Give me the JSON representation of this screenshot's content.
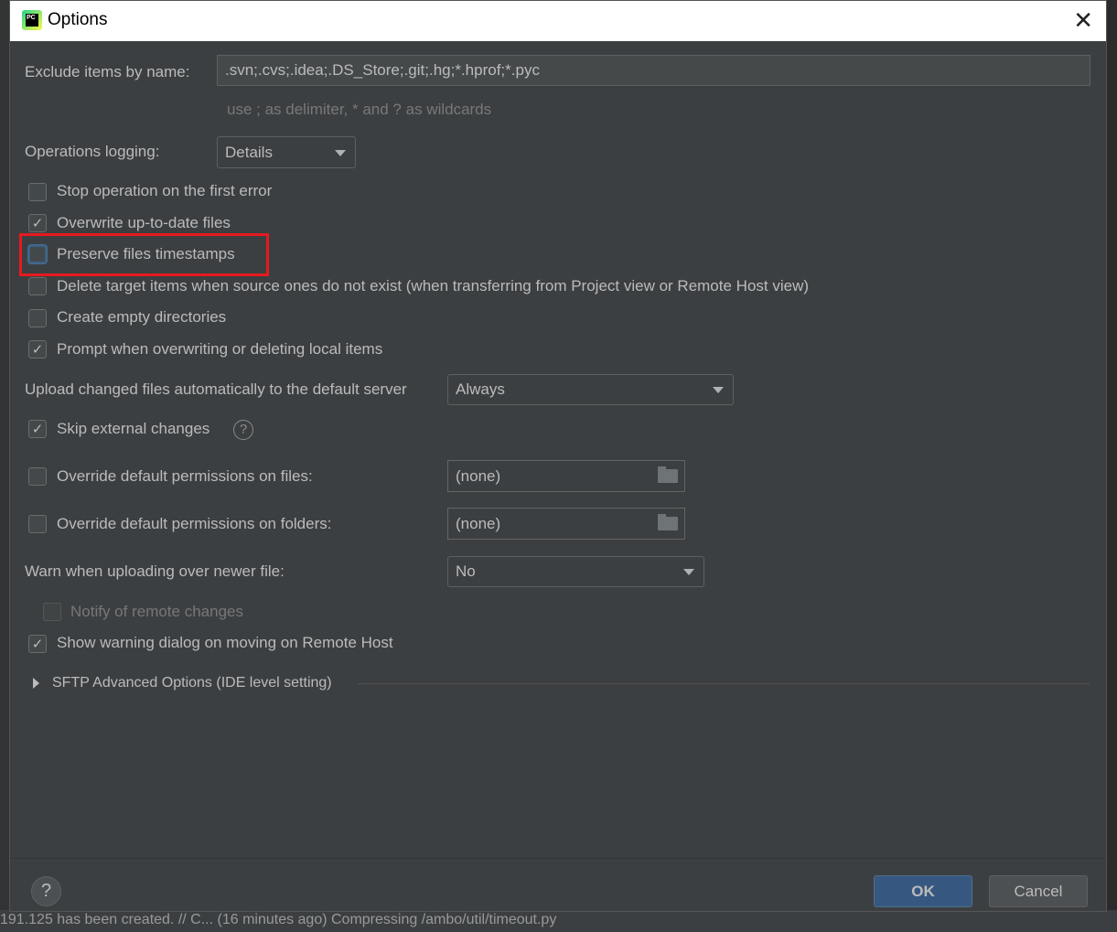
{
  "window": {
    "title": "Options",
    "close_icon": "close-icon"
  },
  "exclude": {
    "label": "Exclude items by name:",
    "value": ".svn;.cvs;.idea;.DS_Store;.git;.hg;*.hprof;*.pyc",
    "hint": "use ; as delimiter, * and ? as wildcards"
  },
  "operations_logging": {
    "label": "Operations logging:",
    "value": "Details"
  },
  "checkboxes": [
    {
      "label": "Stop operation on the first error",
      "checked": false
    },
    {
      "label": "Overwrite up-to-date files",
      "checked": true
    },
    {
      "label": "Preserve files timestamps",
      "checked": false
    },
    {
      "label": "Delete target items when source ones do not exist (when transferring from Project view or Remote Host view)",
      "checked": false
    },
    {
      "label": "Create empty directories",
      "checked": false
    },
    {
      "label": "Prompt when overwriting or deleting local items",
      "checked": true
    }
  ],
  "upload": {
    "label": "Upload changed files automatically to the default server",
    "value": "Always"
  },
  "skip_external": {
    "label": "Skip external changes",
    "checked": true
  },
  "override_files": {
    "label": "Override default permissions on files:",
    "checked": false,
    "value": "(none)"
  },
  "override_folders": {
    "label": "Override default permissions on folders:",
    "checked": false,
    "value": "(none)"
  },
  "warn": {
    "label": "Warn when uploading over newer file:",
    "value": "No"
  },
  "notify": {
    "label": "Notify of remote changes",
    "checked": false,
    "disabled": true
  },
  "show_warning": {
    "label": "Show warning dialog on moving on Remote Host",
    "checked": true
  },
  "sftp": {
    "label": "SFTP Advanced Options (IDE level setting)"
  },
  "footer": {
    "help": "?",
    "ok": "OK",
    "cancel": "Cancel"
  },
  "background_status": "191.125 has been created. // C... (16 minutes ago)    Compressing /ambo/util/timeout.py"
}
